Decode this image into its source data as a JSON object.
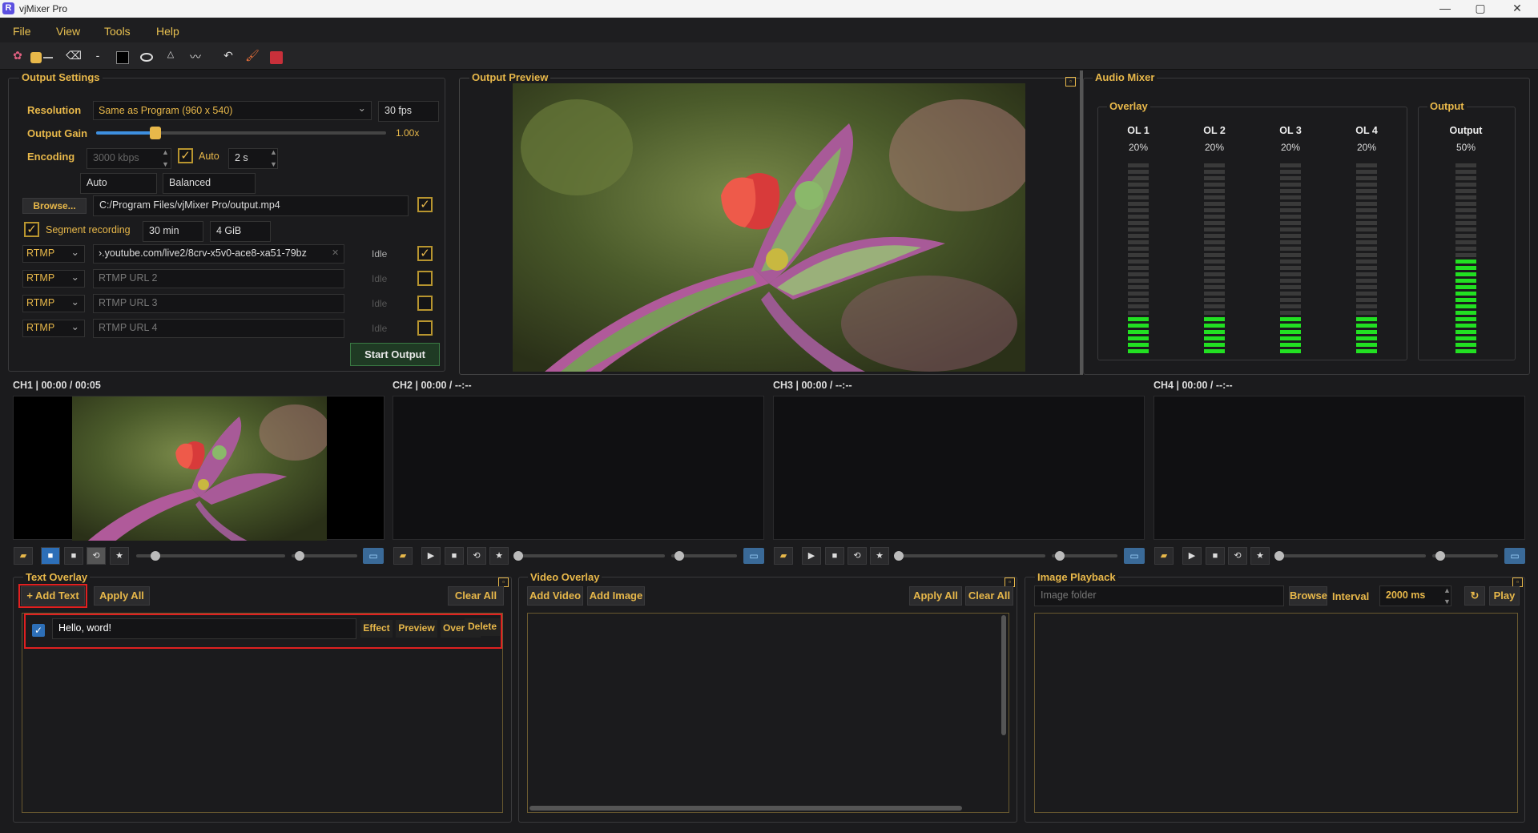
{
  "window": {
    "title": "vjMixer Pro",
    "logo": "R",
    "controls": [
      "—",
      "▢",
      "✕"
    ]
  },
  "menu": [
    "File",
    "View",
    "Tools",
    "Help"
  ],
  "output_settings": {
    "title": "Output Settings",
    "resolution_label": "Resolution",
    "resolution_value": "Same as Program (960 x 540)",
    "fps_value": "30 fps",
    "output_gain_label": "Output Gain",
    "gain_value": "1.00x",
    "gain_fraction": 0.2,
    "encoding_label": "Encoding",
    "bitrate_value": "3000 kbps",
    "auto_label": "Auto",
    "keyframe_value": "2 s",
    "encoder_value": "Auto",
    "preset_value": "Balanced",
    "browse_label": "Browse...",
    "path_value": "C:/Program Files/vjMixer Pro/output.mp4",
    "segment_label": "Segment recording",
    "segment_time": "30 min",
    "segment_size": "4 GiB",
    "rtmp_rows": [
      {
        "protocol": "RTMP",
        "url": "›.youtube.com/live2/8crv-x5v0-ace8-xa51-79bz",
        "placeholder": "",
        "status": "Idle",
        "checked": true
      },
      {
        "protocol": "RTMP",
        "url": "",
        "placeholder": "RTMP URL 2",
        "status": "Idle",
        "checked": false
      },
      {
        "protocol": "RTMP",
        "url": "",
        "placeholder": "RTMP URL 3",
        "status": "Idle",
        "checked": false
      },
      {
        "protocol": "RTMP",
        "url": "",
        "placeholder": "RTMP URL 4",
        "status": "Idle",
        "checked": false
      }
    ],
    "start_label": "Start Output"
  },
  "output_preview": {
    "title": "Output Preview"
  },
  "audio_mixer": {
    "title": "Audio Mixer",
    "overlay_group": "Overlay",
    "output_group": "Output",
    "channels": [
      {
        "name": "OL 1",
        "percent": "20%",
        "level": 0.2
      },
      {
        "name": "OL 2",
        "percent": "20%",
        "level": 0.2
      },
      {
        "name": "OL 3",
        "percent": "20%",
        "level": 0.2
      },
      {
        "name": "OL 4",
        "percent": "20%",
        "level": 0.2
      }
    ],
    "output": {
      "name": "Output",
      "percent": "50%",
      "level": 0.5
    }
  },
  "channels": [
    {
      "label": "CH1 | 00:00 / 00:05",
      "has_video": true
    },
    {
      "label": "CH2 | 00:00 / --:--",
      "has_video": false
    },
    {
      "label": "CH3 | 00:00 / --:--",
      "has_video": false
    },
    {
      "label": "CH4 | 00:00 / --:--",
      "has_video": false
    }
  ],
  "text_overlay": {
    "title": "Text Overlay",
    "add_label": "+ Add Text",
    "apply_label": "Apply All",
    "clear_label": "Clear All",
    "items": [
      {
        "text": "Hello, word!",
        "checked": true,
        "effect": "Effect",
        "preview": "Preview",
        "overlay": "Overlay",
        "delete": "Delete"
      }
    ]
  },
  "video_overlay": {
    "title": "Video Overlay",
    "add_video_label": "Add Video",
    "add_image_label": "Add Image",
    "apply_label": "Apply All",
    "clear_label": "Clear All"
  },
  "image_playback": {
    "title": "Image Playback",
    "folder_placeholder": "Image folder",
    "browse_label": "Browse",
    "interval_label": "Interval",
    "interval_value": "2000 ms",
    "play_label": "Play"
  }
}
